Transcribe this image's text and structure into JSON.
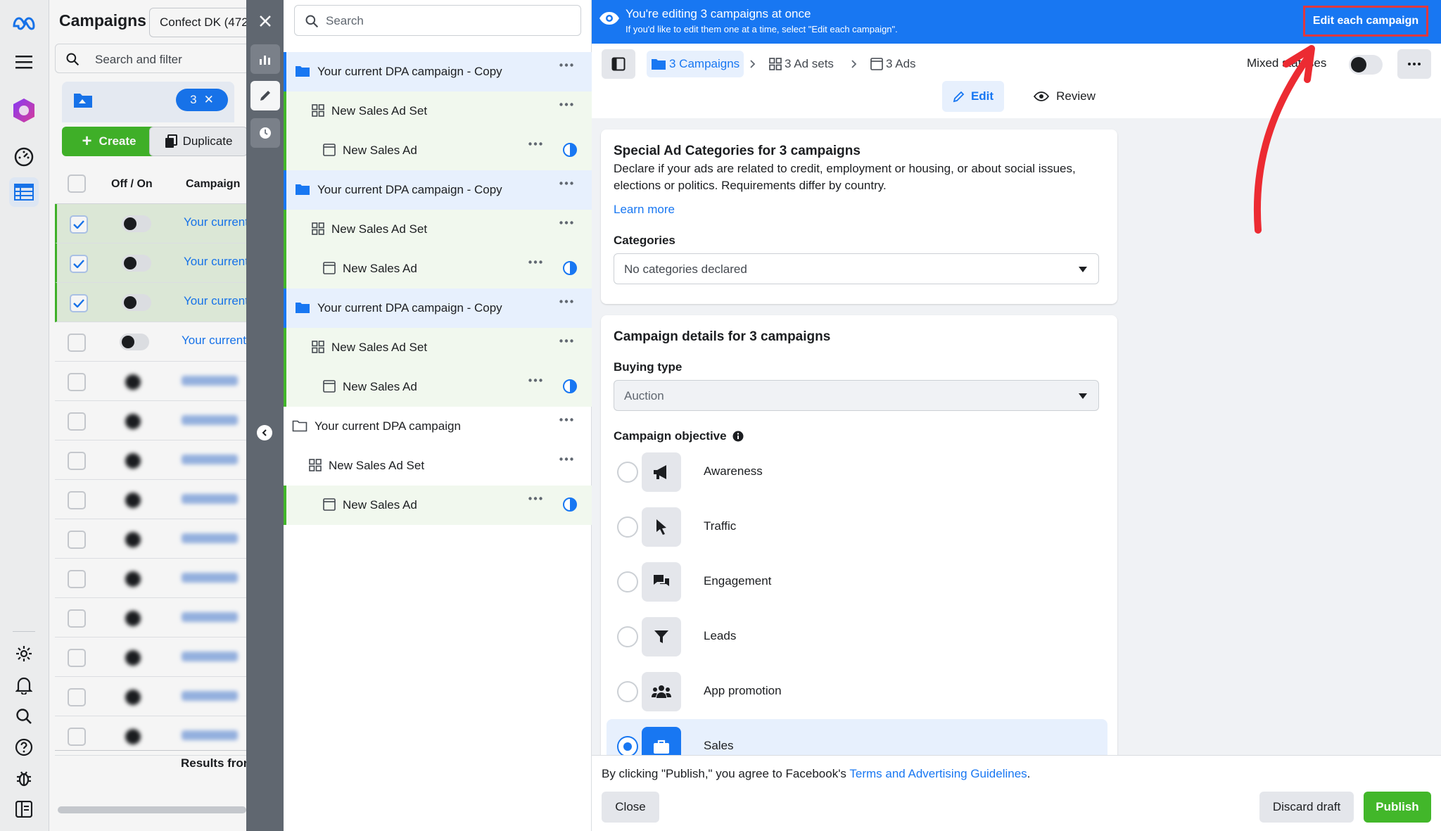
{
  "rail": {
    "icons": [
      "meta-logo-icon",
      "menu-icon",
      "hexagon-logo-icon",
      "dashboard-icon",
      "table-icon",
      "settings-icon",
      "bell-icon",
      "search-icon",
      "help-icon",
      "bug-icon",
      "panel-icon"
    ]
  },
  "table": {
    "title": "Campaigns",
    "account": "Confect DK (472",
    "search_placeholder": "Search and filter",
    "selected_count": "3",
    "create_label": "Create",
    "duplicate_label": "Duplicate",
    "col_offon": "Off / On",
    "col_campaign": "Campaign",
    "rows": [
      {
        "name": "Your current",
        "selected": true
      },
      {
        "name": "Your current",
        "selected": true
      },
      {
        "name": "Your current",
        "selected": true
      },
      {
        "name": "Your current",
        "selected": false
      }
    ],
    "results_label": "Results fron"
  },
  "tree": {
    "search_placeholder": "Search",
    "items": [
      {
        "type": "campaign",
        "label": "Your current DPA campaign - Copy",
        "highlight": "blue"
      },
      {
        "type": "adset",
        "label": "New Sales Ad Set",
        "highlight": "green"
      },
      {
        "type": "ad",
        "label": "New Sales Ad",
        "highlight": "green"
      },
      {
        "type": "campaign",
        "label": "Your current DPA campaign - Copy",
        "highlight": "blue"
      },
      {
        "type": "adset",
        "label": "New Sales Ad Set",
        "highlight": "green"
      },
      {
        "type": "ad",
        "label": "New Sales Ad",
        "highlight": "green"
      },
      {
        "type": "campaign",
        "label": "Your current DPA campaign - Copy",
        "highlight": "blue"
      },
      {
        "type": "adset",
        "label": "New Sales Ad Set",
        "highlight": "green"
      },
      {
        "type": "ad",
        "label": "New Sales Ad",
        "highlight": "green"
      },
      {
        "type": "campaign",
        "label": "Your current DPA campaign",
        "highlight": "none"
      },
      {
        "type": "adset",
        "label": "New Sales Ad Set",
        "highlight": "none"
      },
      {
        "type": "ad",
        "label": "New Sales Ad",
        "highlight": "green"
      }
    ]
  },
  "banner": {
    "title": "You're editing 3 campaigns at once",
    "subtitle": "If you'd like to edit them one at a time, select \"Edit each campaign\".",
    "edit_each": "Edit each campaign"
  },
  "breadcrumb": {
    "campaigns": "3 Campaigns",
    "adsets": "3 Ad sets",
    "ads": "3 Ads"
  },
  "mixed_label": "Mixed statuses",
  "tabs": {
    "edit": "Edit",
    "review": "Review"
  },
  "special_ad": {
    "title": "Special Ad Categories for 3 campaigns",
    "description": "Declare if your ads are related to credit, employment or housing, or about social issues, elections or politics. Requirements differ by country.",
    "learn_more": "Learn more",
    "categories_label": "Categories",
    "categories_value": "No categories declared"
  },
  "campaign_details": {
    "title": "Campaign details for 3 campaigns",
    "buying_type_label": "Buying type",
    "buying_type_value": "Auction",
    "objective_label": "Campaign objective",
    "objectives": [
      {
        "label": "Awareness",
        "icon": "megaphone-icon",
        "selected": false
      },
      {
        "label": "Traffic",
        "icon": "cursor-icon",
        "selected": false
      },
      {
        "label": "Engagement",
        "icon": "chat-bubbles-icon",
        "selected": false
      },
      {
        "label": "Leads",
        "icon": "funnel-icon",
        "selected": false
      },
      {
        "label": "App promotion",
        "icon": "people-icon",
        "selected": false
      },
      {
        "label": "Sales",
        "icon": "briefcase-icon",
        "selected": true
      }
    ]
  },
  "footer": {
    "agree_prefix": "By clicking \"Publish,\" you agree to Facebook's ",
    "agree_link": "Terms and Advertising Guidelines",
    "agree_suffix": ".",
    "close": "Close",
    "discard": "Discard draft",
    "publish": "Publish"
  },
  "colors": {
    "accent": "#1877f2",
    "publish_green": "#42b72a",
    "annotation_red": "#e0383e"
  }
}
